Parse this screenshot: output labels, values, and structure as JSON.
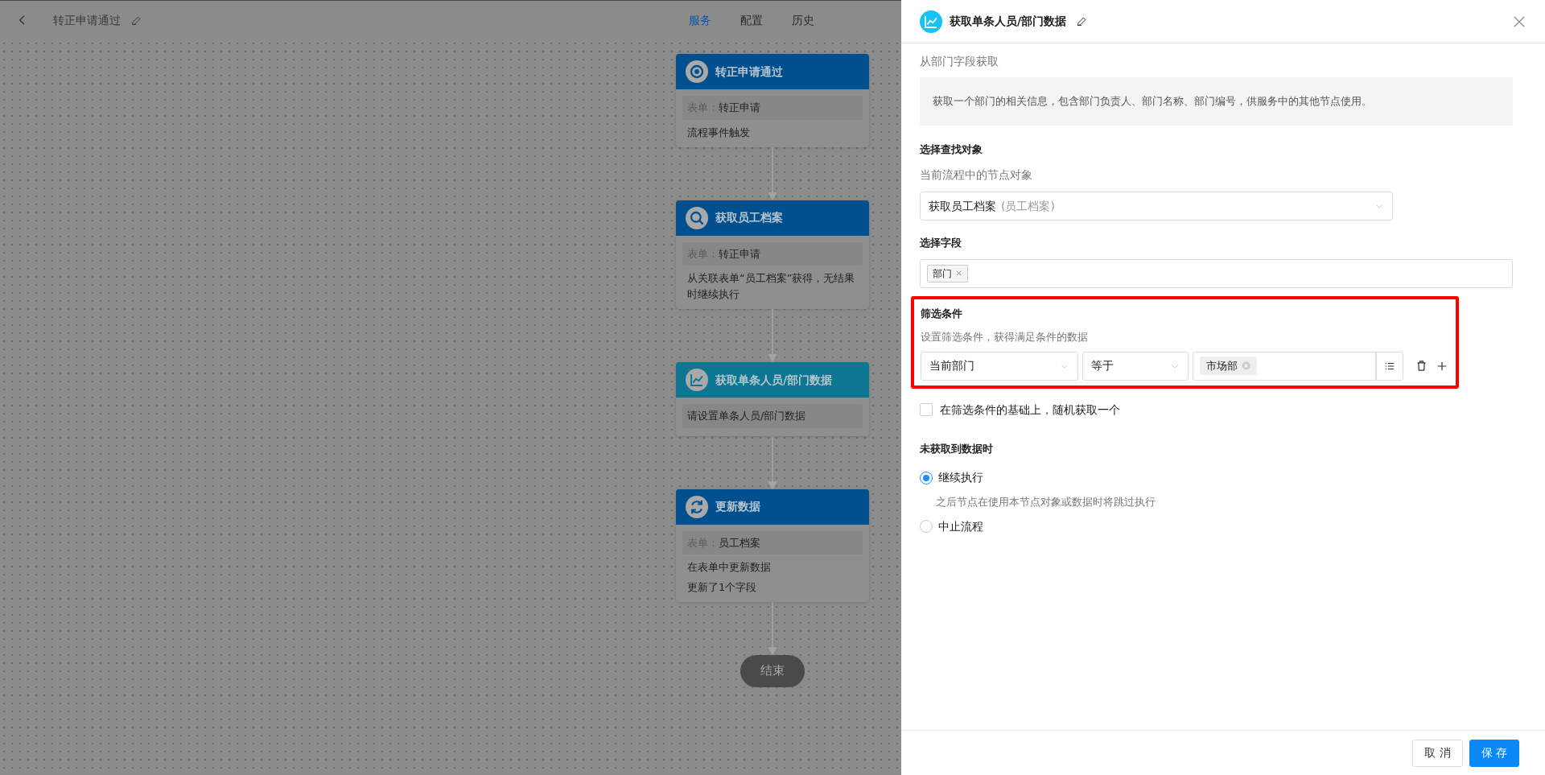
{
  "header": {
    "title": "转正申请通过",
    "tabs": [
      {
        "label": "服务",
        "selected": true
      },
      {
        "label": "配置",
        "selected": false
      },
      {
        "label": "历史",
        "selected": false
      }
    ]
  },
  "flow": {
    "nodes": [
      {
        "kind": "trigger",
        "title": "转正申请通过",
        "color": "#00508f",
        "fields": [
          {
            "label": "表单：",
            "value": "转正申请"
          }
        ],
        "lines": [
          "流程事件触发"
        ]
      },
      {
        "kind": "search",
        "title": "获取员工档案",
        "color": "#00508f",
        "fields": [
          {
            "label": "表单：",
            "value": "转正申请"
          }
        ],
        "lines": [
          "从关联表单“员工档案”获得，无结果时继续执行"
        ]
      },
      {
        "kind": "chart",
        "title": "获取单条人员/部门数据",
        "color": "#0d7690",
        "fields": [
          {
            "value": "请设置单条人员/部门数据"
          }
        ]
      },
      {
        "kind": "refresh",
        "title": "更新数据",
        "color": "#00508f",
        "fields": [
          {
            "label": "表单：",
            "value": "员工档案"
          }
        ],
        "lines": [
          "在表单中更新数据",
          "更新了1个字段"
        ]
      }
    ],
    "end": "结束"
  },
  "panel": {
    "title": "获取单条人员/部门数据",
    "subtitle": "从部门字段获取",
    "description": "获取一个部门的相关信息，包含部门负责人、部门名称、部门编号，供服务中的其他节点使用。",
    "object_section": {
      "title": "选择查找对象",
      "hint": "当前流程中的节点对象",
      "select": {
        "value": "获取员工档案",
        "note": "(员工档案)"
      }
    },
    "field_section": {
      "title": "选择字段",
      "tags": [
        "部门"
      ]
    },
    "filter_section": {
      "title": "筛选条件",
      "highlighted": true,
      "hint": "设置筛选条件，获得满足条件的数据",
      "conditions": [
        {
          "field": "当前部门",
          "operator": "等于",
          "values": [
            "市场部"
          ]
        }
      ]
    },
    "random_option": {
      "label": "在筛选条件的基础上，随机获取一个",
      "checked": false
    },
    "empty_section": {
      "title": "未获取到数据时",
      "options": [
        {
          "label": "继续执行",
          "selected": true,
          "hint": "之后节点在使用本节点对象或数据时将跳过执行"
        },
        {
          "label": "中止流程",
          "selected": false
        }
      ]
    },
    "buttons": [
      {
        "label": "取 消",
        "kind": "secondary"
      },
      {
        "label": "保 存",
        "kind": "primary"
      }
    ]
  }
}
